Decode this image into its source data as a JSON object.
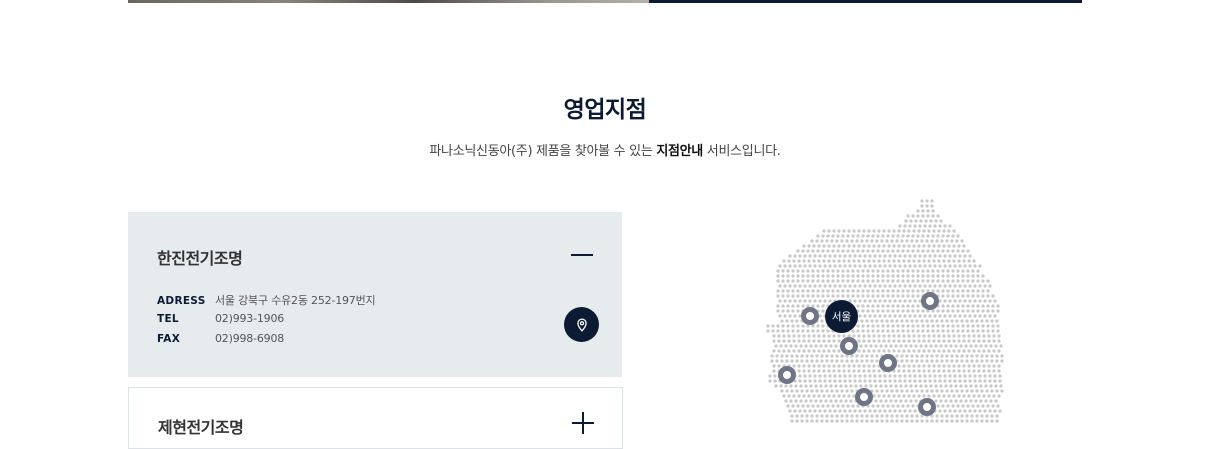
{
  "section": {
    "title": "영업지점",
    "desc_before": "파나소닉신동아(주) 제품을 찾아볼 수 있는 ",
    "desc_bold": "지점안내",
    "desc_after": " 서비스입니다."
  },
  "branches": [
    {
      "name": "한진전기조명",
      "expanded": true,
      "address_label": "ADRESS",
      "address": "서울 강북구 수유2동 252-197번지",
      "tel_label": "TEL",
      "tel": "02)993-1906",
      "fax_label": "FAX",
      "fax": "02)998-6908"
    },
    {
      "name": "제현전기조명",
      "expanded": false
    }
  ],
  "map": {
    "selected_region": "서울"
  },
  "colors": {
    "navy": "#0d1a33",
    "panel_bg": "#e6ecee",
    "dot": "#c8c8c8",
    "marker": "#6f7585"
  }
}
